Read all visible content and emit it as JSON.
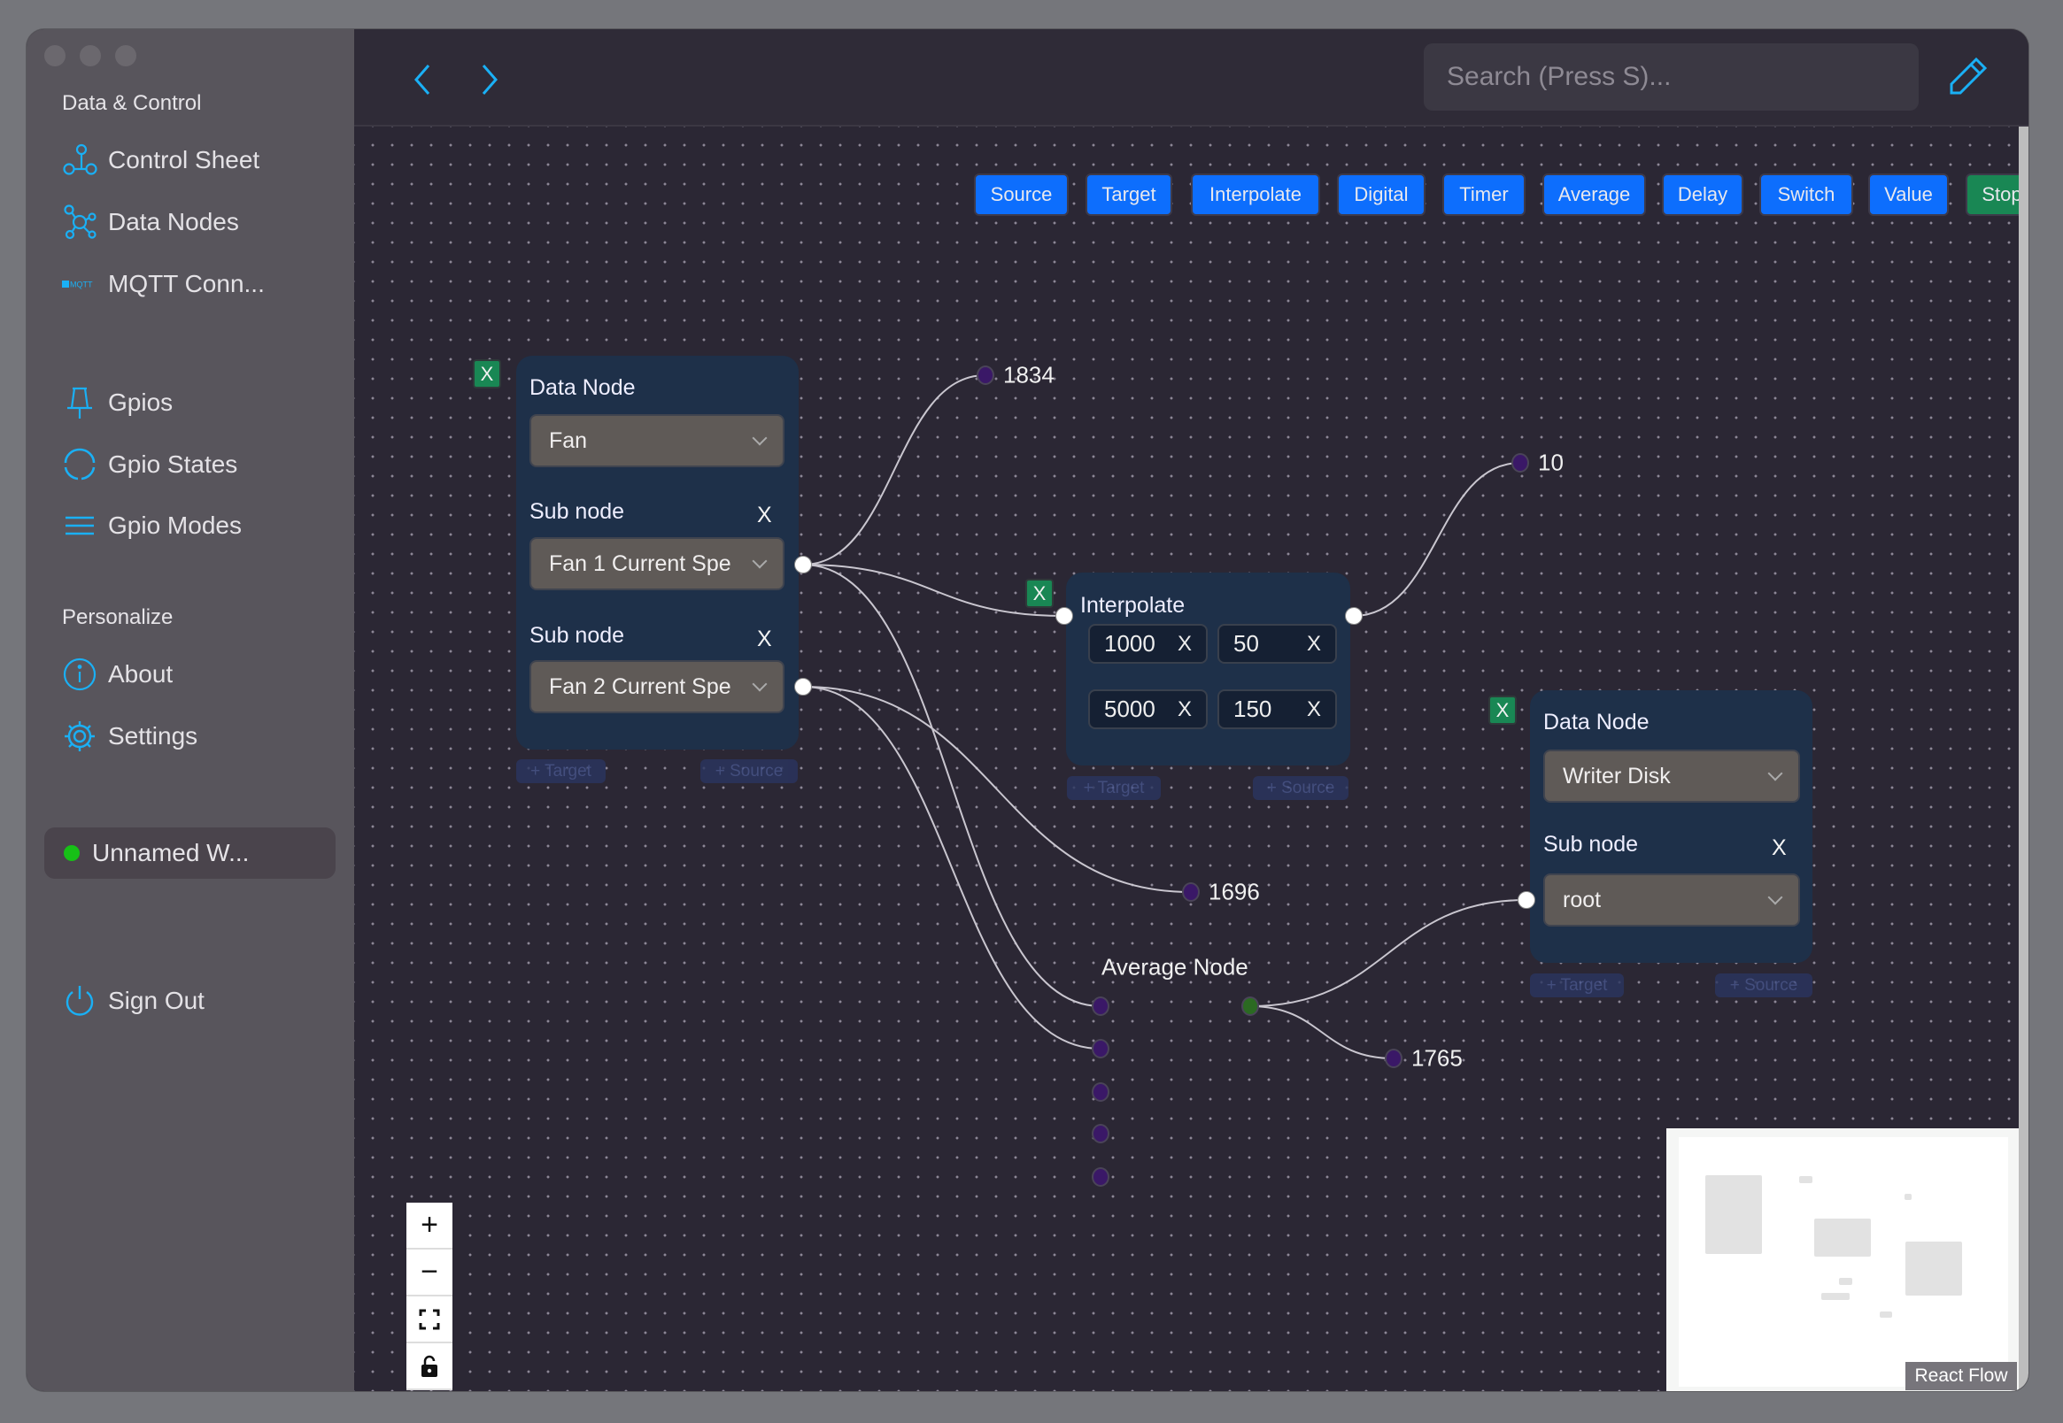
{
  "sidebar": {
    "section_data": "Data & Control",
    "items": [
      {
        "label": "Control Sheet",
        "icon": "control-sheet-icon"
      },
      {
        "label": "Data Nodes",
        "icon": "data-nodes-icon"
      },
      {
        "label": "MQTT Conn...",
        "icon": "mqtt-icon"
      },
      {
        "label": "Gpios",
        "icon": "pin-icon"
      },
      {
        "label": "Gpio States",
        "icon": "circle-icon"
      },
      {
        "label": "Gpio Modes",
        "icon": "menu-icon"
      }
    ],
    "section_personalize": "Personalize",
    "personal_items": [
      {
        "label": "About",
        "icon": "info-icon"
      },
      {
        "label": "Settings",
        "icon": "gear-icon"
      }
    ],
    "workspace": {
      "label": "Unnamed W...",
      "status_color": "#17c017"
    },
    "sign_out": "Sign Out",
    "mqtt_logo": "MQTT"
  },
  "header": {
    "search_placeholder": "Search (Press S)..."
  },
  "toolbar": {
    "buttons": [
      "Source",
      "Target",
      "Interpolate",
      "Digital",
      "Timer",
      "Average",
      "Delay",
      "Switch",
      "Value",
      "Stop"
    ],
    "accent": "#0d6efd",
    "stop_color": "#198754"
  },
  "nodes": {
    "data_node_1": {
      "title": "Data Node",
      "node_value": "Fan",
      "sub_label": "Sub node",
      "sub1": "Fan 1 Current Spe",
      "sub2": "Fan 2 Current Spe",
      "remove": "X",
      "add_target": "+ Target",
      "add_source": "+ Source"
    },
    "interpolate": {
      "title": "Interpolate",
      "remove": "X",
      "rows": [
        [
          "1000",
          "50"
        ],
        [
          "5000",
          "150"
        ]
      ],
      "add_target": "+ Target",
      "add_source": "+ Source"
    },
    "data_node_2": {
      "title": "Data Node",
      "node_value": "Writer Disk",
      "sub_label": "Sub node",
      "sub1": "root",
      "remove": "X",
      "add_target": "+ Target",
      "add_source": "+ Source"
    },
    "average": {
      "title": "Average Node"
    },
    "values": [
      "1834",
      "10",
      "1696",
      "1765"
    ]
  },
  "controls": {
    "zoom_in": "+",
    "zoom_out": "−"
  },
  "attribution": "React Flow"
}
